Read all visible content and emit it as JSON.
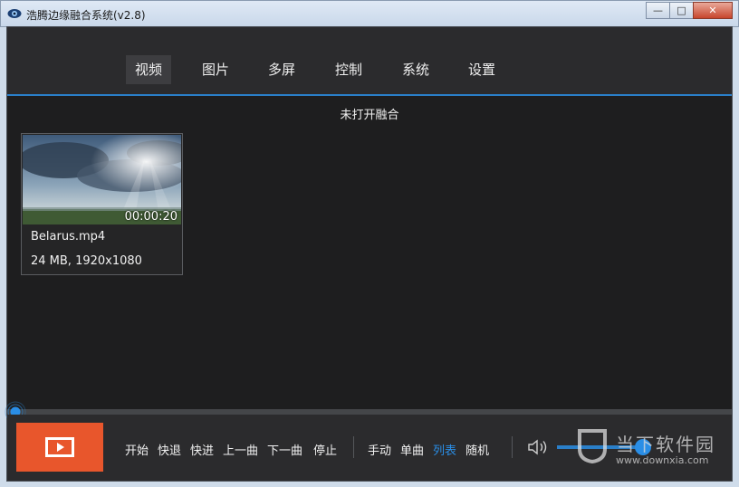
{
  "window": {
    "title": "浩腾边缘融合系统(v2.8)",
    "buttons": {
      "minimize": "—",
      "maximize": "□",
      "close": "✕"
    }
  },
  "nav": {
    "tabs": [
      {
        "label": "视频",
        "active": true
      },
      {
        "label": "图片"
      },
      {
        "label": "多屏"
      },
      {
        "label": "控制"
      },
      {
        "label": "系统"
      },
      {
        "label": "设置"
      }
    ]
  },
  "status": {
    "text": "未打开融合"
  },
  "media": {
    "items": [
      {
        "name": "Belarus.mp4",
        "info": "24 MB, 1920x1080",
        "duration": "00:00:20"
      }
    ]
  },
  "playback": {
    "progress_fraction": 0.0
  },
  "controls": {
    "transport": [
      "开始",
      "快退",
      "快进",
      "上一曲",
      "下一曲",
      "停止"
    ],
    "modes": [
      {
        "label": "手动"
      },
      {
        "label": "单曲"
      },
      {
        "label": "列表",
        "active": true
      },
      {
        "label": "随机"
      }
    ],
    "volume_fraction": 0.95
  },
  "watermark": {
    "text": "当下软件园",
    "url": "www.downxia.com"
  },
  "colors": {
    "accent": "#2a7fc9",
    "play": "#e8562c",
    "background": "#1e1e1f"
  }
}
